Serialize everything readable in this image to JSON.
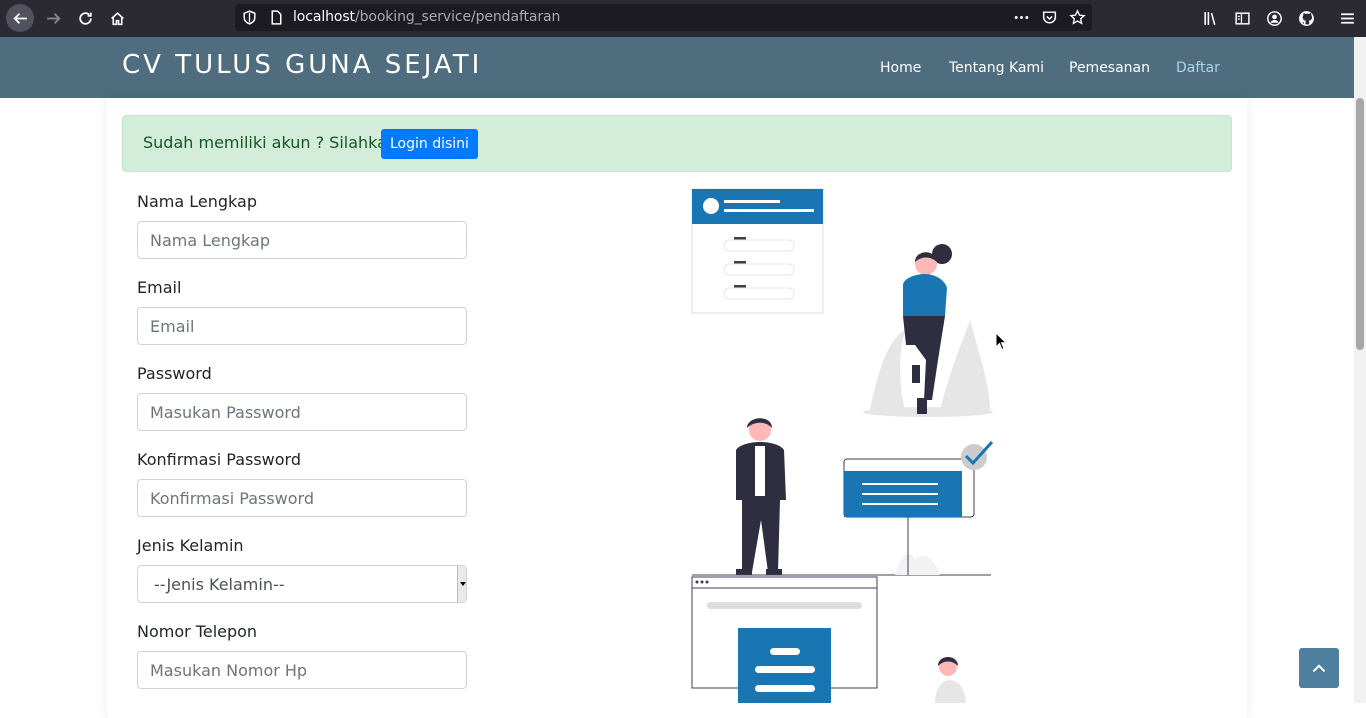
{
  "browser": {
    "url_host": "localhost",
    "url_path": "/booking_service/pendaftaran",
    "icons": [
      "back-arrow-icon",
      "forward-arrow-icon",
      "reload-icon",
      "home-icon",
      "shield-icon",
      "page-icon",
      "more-icon",
      "pocket-icon",
      "star-icon",
      "library-icon",
      "sidebar-icon",
      "account-icon",
      "github-icon",
      "menu-icon"
    ]
  },
  "navbar": {
    "brand": "CV TULUS GUNA SEJATI",
    "links": [
      {
        "label": "Home"
      },
      {
        "label": "Tentang Kami"
      },
      {
        "label": "Pemesanan"
      },
      {
        "label": "Daftar",
        "active": true
      }
    ],
    "bg_color": "#4f6d7e",
    "active_color": "#a6d4ee"
  },
  "alert": {
    "text": "Sudah memiliki akun ? Silahkan",
    "button_label": "Login disini"
  },
  "form": {
    "fields": [
      {
        "label": "Nama Lengkap",
        "placeholder": "Nama Lengkap"
      },
      {
        "label": "Email",
        "placeholder": "Email"
      },
      {
        "label": "Password",
        "placeholder": "Masukan Password"
      },
      {
        "label": "Konfirmasi Password",
        "placeholder": "Konfirmasi Password"
      },
      {
        "label": "Jenis Kelamin",
        "selected": "--Jenis Kelamin--"
      },
      {
        "label": "Nomor Telepon",
        "placeholder": "Masukan Nomor Hp"
      }
    ]
  },
  "colors": {
    "accent": "#1976b2",
    "alert_bg": "#d4edda",
    "alert_text": "#155724",
    "button": "#007bff"
  }
}
